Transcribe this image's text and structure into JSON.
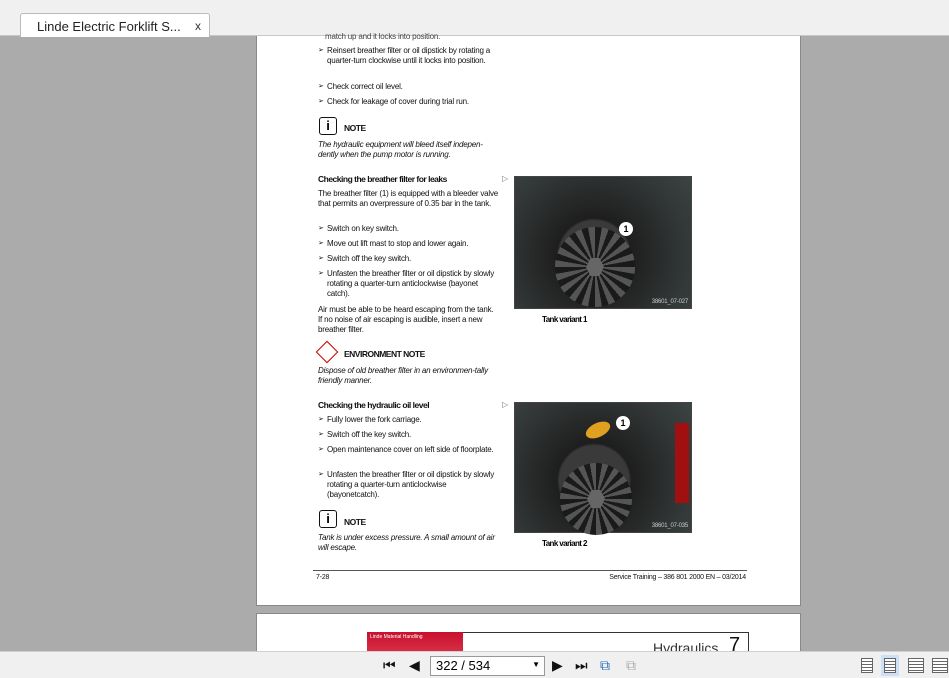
{
  "tab": {
    "title": "Linde Electric Forklift S...",
    "close": "x"
  },
  "page": {
    "top_fragment": "match up and it locks into position.",
    "bullets_top": [
      "Reinsert breather filter or oil dipstick by rotating a quarter-turn clockwise until it locks into position.",
      "Check correct oil level.",
      "Check for leakage of cover during trial run."
    ],
    "note1_label": "NOTE",
    "note1_icon": "i",
    "note1_text": "The hydraulic equipment will bleed itself indepen-dently when the pump motor is running.",
    "sec1_heading": "Checking the breather filter for leaks",
    "sec1_intro": "The breather filter (1) is equipped with a bleeder valve that permits an overpressure of 0.35 bar in the tank.",
    "sec1_bullets": [
      "Switch on key switch.",
      "Move out lift mast to stop and lower again.",
      "Switch off the key switch.",
      "Unfasten the breather filter or oil dipstick by slowly rotating a quarter-turn anticlockwise (bayonet catch)."
    ],
    "sec1_after": "Air must be able to be heard escaping from the tank. If no noise of air escaping is audible, insert a new breather filter.",
    "env_label": "ENVIRONMENT NOTE",
    "env_text": "Dispose of old breather filter in an environmen-tally friendly manner.",
    "sec2_heading": "Checking the hydraulic oil level",
    "sec2_bullets": [
      "Fully lower the fork carriage.",
      "Switch off the key switch.",
      "Open maintenance cover on left side of floorplate.",
      "Unfasten the breather filter or oil dipstick by slowly rotating a quarter-turn anticlockwise (bayonetcatch)."
    ],
    "note2_label": "NOTE",
    "note2_icon": "i",
    "note2_text": "Tank is under excess pressure. A small amount of air will escape.",
    "fig1": {
      "callout": "1",
      "code": "38601_07-027",
      "caption": "Tank variant 1"
    },
    "fig2": {
      "callout": "1",
      "code": "38601_07-035",
      "caption": "Tank variant 2"
    },
    "footer_left": "7-28",
    "footer_right": "Service Training – 386 801 2000 EN – 03/2014"
  },
  "page2": {
    "banner_text": "Linde Material Handling",
    "title": "Hydraulics",
    "chapter": "7"
  },
  "toolbar": {
    "page_value": "322 / 534"
  }
}
